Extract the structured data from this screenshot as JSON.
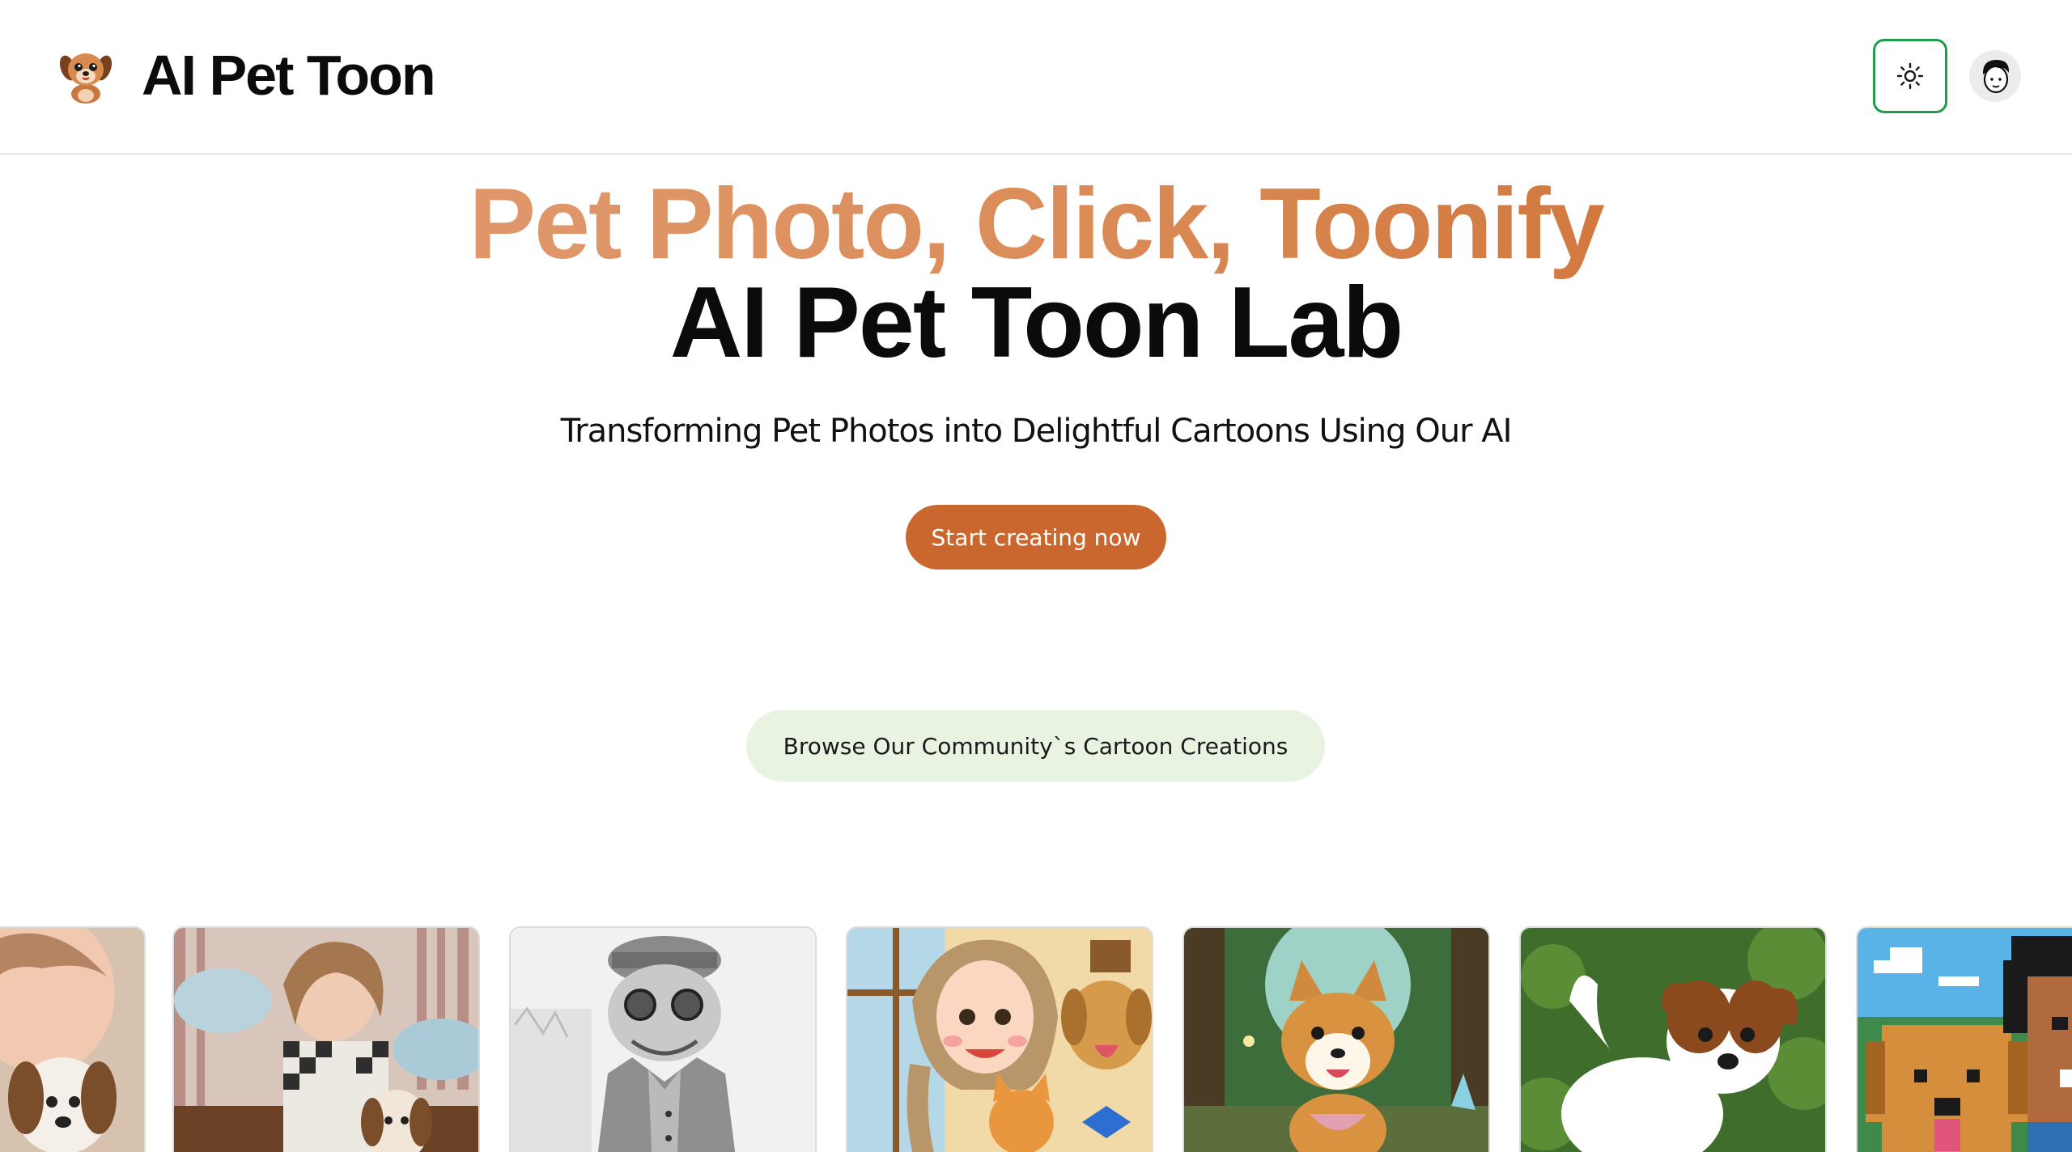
{
  "header": {
    "brand": "AI Pet Toon",
    "logo_icon": "cartoon-puppy-logo",
    "theme_toggle_icon": "sun-icon",
    "avatar_icon": "user-avatar"
  },
  "hero": {
    "headline_line1": "Pet Photo, Click, Toonify",
    "headline_line2": "AI Pet Toon Lab",
    "subtitle": "Transforming Pet Photos into Delightful Cartoons Using Our AI",
    "cta_label": "Start creating now"
  },
  "community": {
    "label": "Browse Our Community`s Cartoon Creations"
  },
  "gallery": {
    "items": [
      {
        "name": "woman-with-beagle-portrait"
      },
      {
        "name": "smiling-woman-with-beagle-on-couch"
      },
      {
        "name": "pencil-sketch-cat-in-coat"
      },
      {
        "name": "cartoon-girl-with-cat-and-dog"
      },
      {
        "name": "corgi-in-fairy-forest"
      },
      {
        "name": "painted-jack-russell-puppy"
      },
      {
        "name": "pixel-art-golden-retriever-with-man"
      }
    ]
  },
  "colors": {
    "accent": "#c9672e",
    "headline_gradient_start": "#e2a07a",
    "headline_gradient_end": "#c8682a",
    "community_bg": "#e8f3e1",
    "theme_border": "#1e9e4a"
  }
}
